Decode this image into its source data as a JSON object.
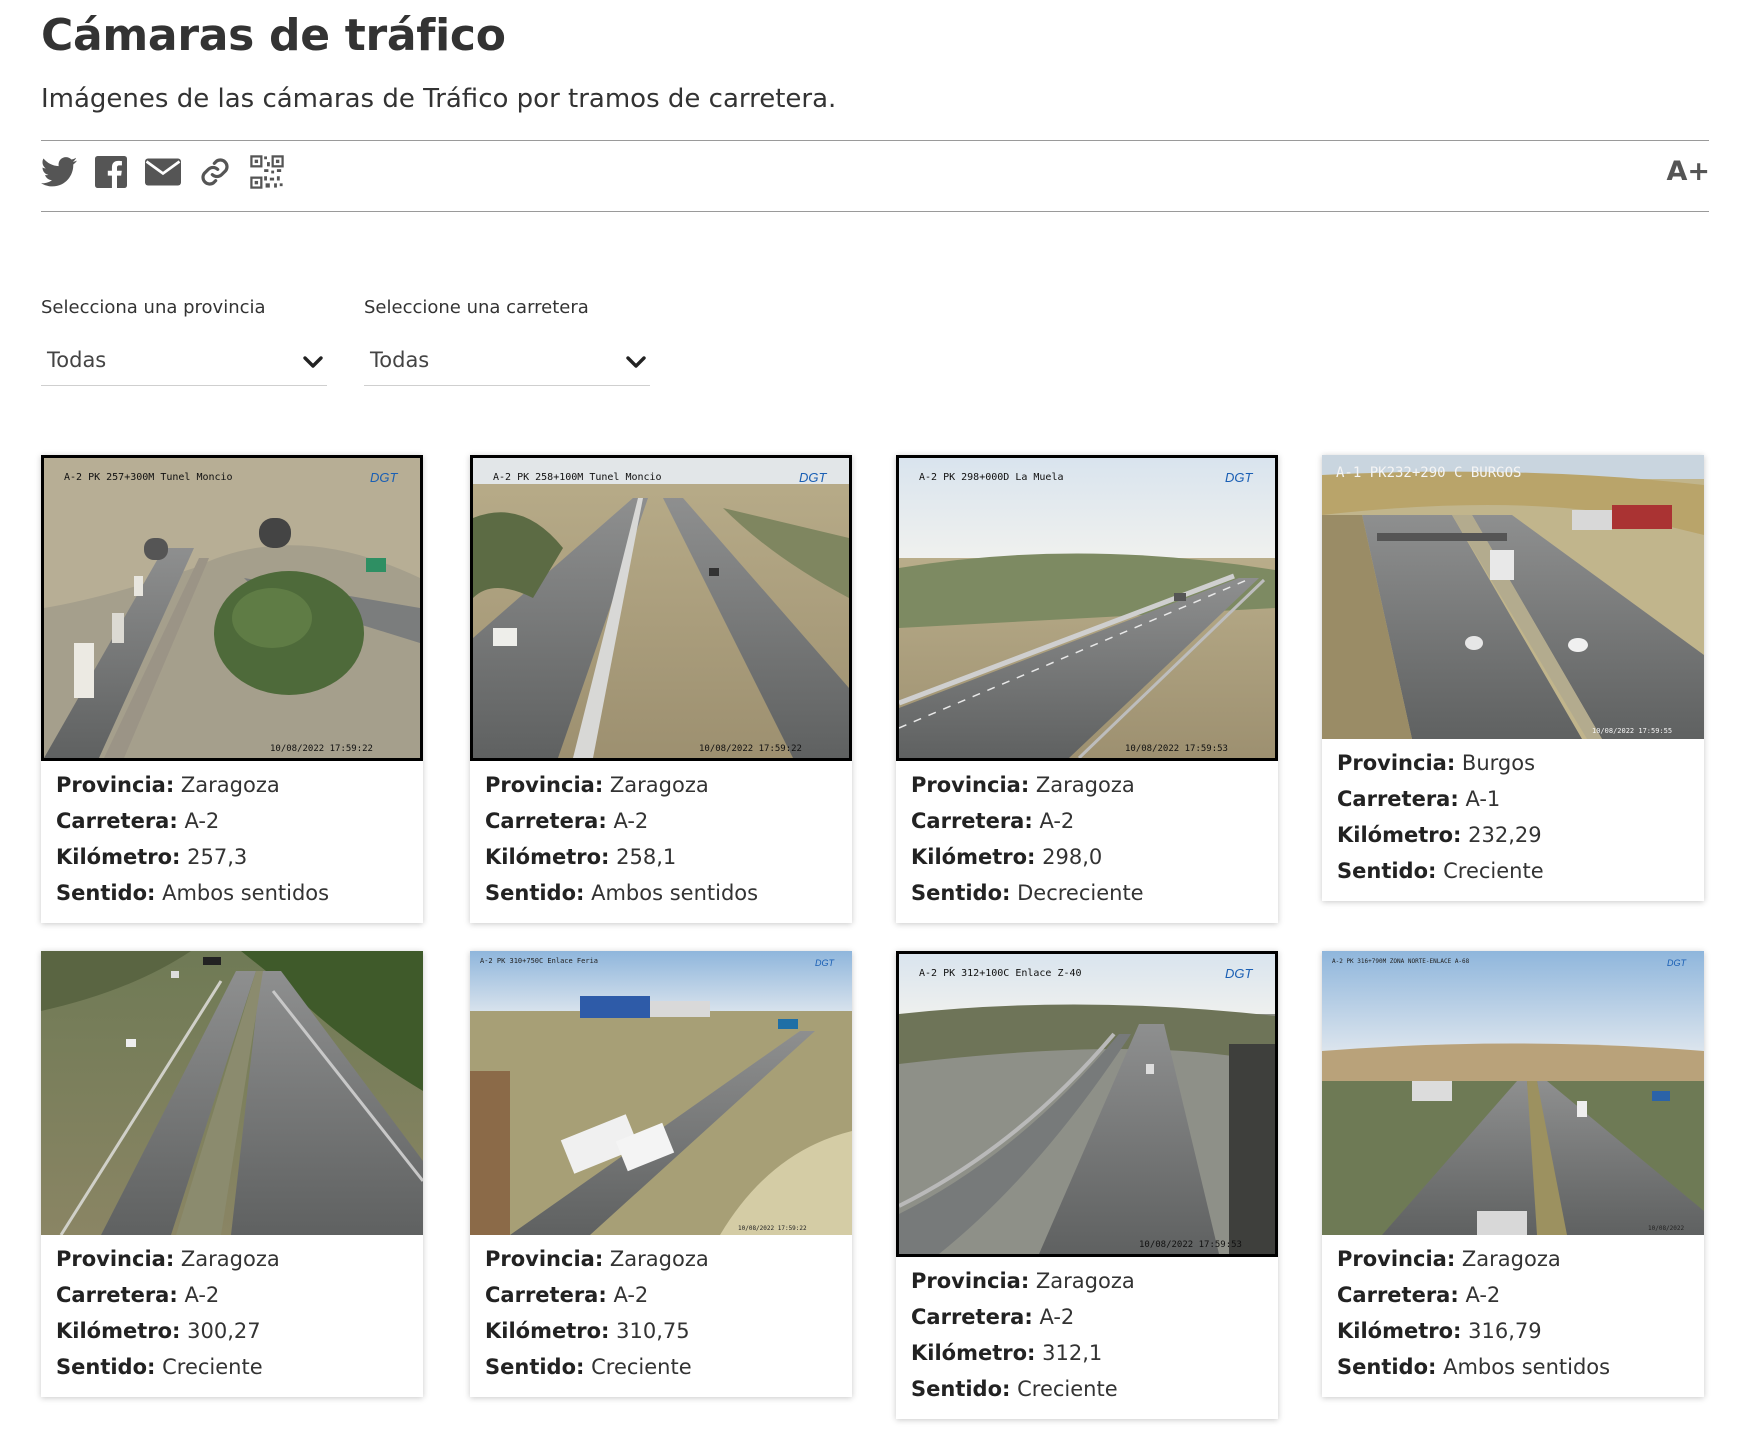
{
  "header": {
    "title": "Cámaras de tráfico",
    "subtitle": "Imágenes de las cámaras de Tráfico por tramos de carretera."
  },
  "share": {
    "icons": [
      "twitter-icon",
      "facebook-icon",
      "email-icon",
      "link-icon",
      "qr-code-icon"
    ],
    "font_size_label": "A+"
  },
  "filters": {
    "province_label": "Selecciona una provincia",
    "province_value": "Todas",
    "road_label": "Seleccione una carretera",
    "road_value": "Todas"
  },
  "field_labels": {
    "province": "Provincia:",
    "road": "Carretera:",
    "km": "Kilómetro:",
    "direction": "Sentido:"
  },
  "cameras": [
    {
      "overlay": "A-2 PK 257+300M Tunel Moncio",
      "timestamp": "10/08/2022 17:59:22",
      "provincia": "Zaragoza",
      "carretera": "A-2",
      "kilometro": "257,3",
      "sentido": "Ambos sentidos"
    },
    {
      "overlay": "A-2 PK 258+100M Tunel Moncio",
      "timestamp": "10/08/2022 17:59:22",
      "provincia": "Zaragoza",
      "carretera": "A-2",
      "kilometro": "258,1",
      "sentido": "Ambos sentidos"
    },
    {
      "overlay": "A-2 PK 298+000D La Muela",
      "timestamp": "10/08/2022 17:59:53",
      "provincia": "Zaragoza",
      "carretera": "A-2",
      "kilometro": "298,0",
      "sentido": "Decreciente"
    },
    {
      "overlay": "A-1 PK232+290 C BURGOS",
      "timestamp": "10/08/2022 17:59:55",
      "provincia": "Burgos",
      "carretera": "A-1",
      "kilometro": "232,29",
      "sentido": "Creciente"
    },
    {
      "overlay": "",
      "timestamp": "",
      "provincia": "Zaragoza",
      "carretera": "A-2",
      "kilometro": "300,27",
      "sentido": "Creciente"
    },
    {
      "overlay": "A-2 PK 310+750C Enlace Feria",
      "timestamp": "10/08/2022 17:59:22",
      "provincia": "Zaragoza",
      "carretera": "A-2",
      "kilometro": "310,75",
      "sentido": "Creciente"
    },
    {
      "overlay": "A-2 PK 312+100C Enlace Z-40",
      "timestamp": "10/08/2022 17:59:53",
      "provincia": "Zaragoza",
      "carretera": "A-2",
      "kilometro": "312,1",
      "sentido": "Creciente"
    },
    {
      "overlay": "A-2 PK 316+790M ZONA NORTE-ENLACE A-68",
      "timestamp": "10/08/2022",
      "provincia": "Zaragoza",
      "carretera": "A-2",
      "kilometro": "316,79",
      "sentido": "Ambos sentidos"
    }
  ],
  "brand": {
    "logo_text": "DGT",
    "logo_color": "#1a5fb4"
  }
}
